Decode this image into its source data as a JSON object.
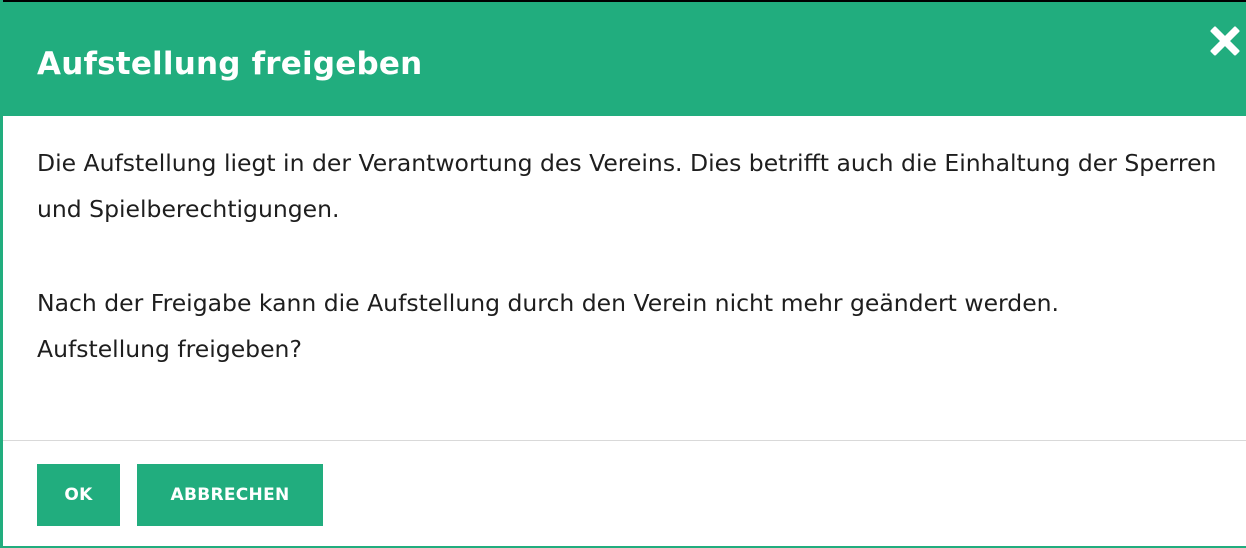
{
  "dialog": {
    "title": "Aufstellung freigeben",
    "close_icon": "close-icon",
    "body": {
      "paragraph_1": "Die Aufstellung liegt in der Verantwortung des Vereins. Dies betrifft auch die Einhaltung der Sperren und Spielberechtigungen.",
      "paragraph_2": "Nach der Freigabe kann die Aufstellung durch den Verein nicht mehr geändert werden.",
      "question": "Aufstellung freigeben?"
    },
    "buttons": {
      "ok_label": "OK",
      "cancel_label": "ABBRECHEN"
    }
  },
  "colors": {
    "accent": "#21ad7e",
    "header_text": "#ffffff",
    "body_text": "#1e1e1e",
    "divider": "#d9d9d9"
  }
}
